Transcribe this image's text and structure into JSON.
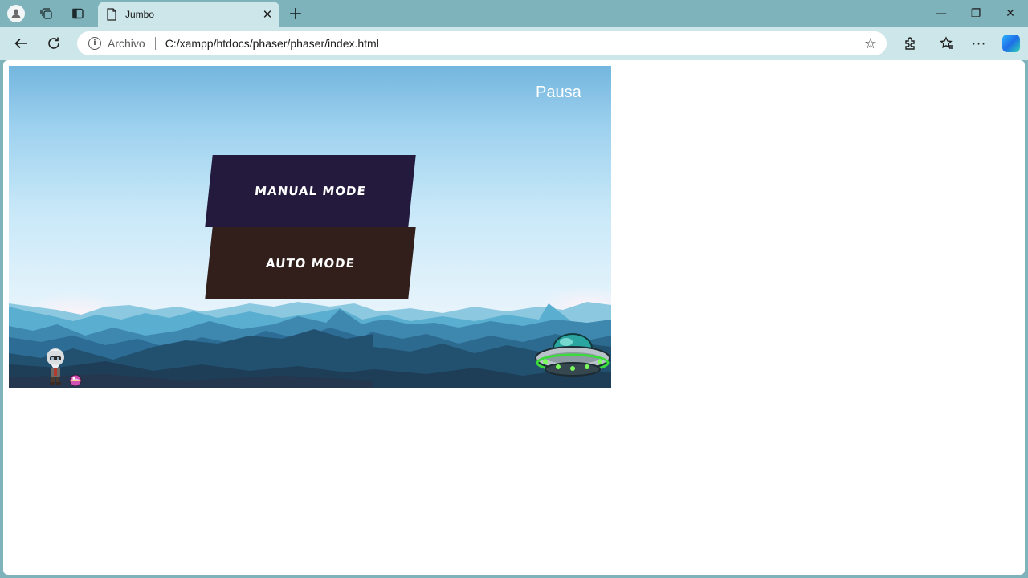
{
  "browser": {
    "tab_title": "Jumbo",
    "tab_close": "✕",
    "new_tab": "+",
    "address": {
      "security_label": "Archivo",
      "url": "C:/xampp/htdocs/phaser/phaser/index.html"
    },
    "icons": {
      "profile": "profile-icon",
      "workspaces": "workspaces-icon",
      "tab_actions": "tab-actions-icon",
      "page": "page-icon",
      "back": "back-arrow-icon",
      "refresh": "refresh-icon",
      "info": "info-icon",
      "favorite": "star-icon",
      "extensions": "extensions-icon",
      "favorites": "favorites-icon",
      "more": "more-icon",
      "copilot": "copilot-icon"
    },
    "window_controls": {
      "minimize": "—",
      "restore": "❐",
      "close": "✕"
    }
  },
  "game": {
    "pause_label": "Pausa",
    "menu": {
      "manual_label": "MANUAL MODE",
      "auto_label": "AUTO MODE"
    },
    "colors": {
      "manual_bg": "#231a3d",
      "auto_bg": "#321f1b"
    },
    "sprites": [
      "player-character",
      "pink-orb",
      "ufo-enemy"
    ]
  }
}
